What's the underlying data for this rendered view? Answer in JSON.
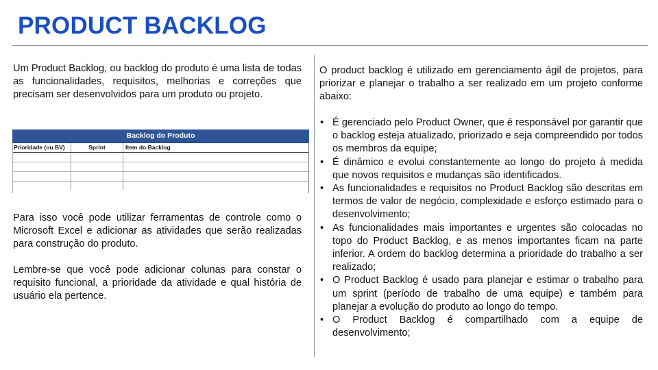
{
  "header": {
    "title": "PRODUCT BACKLOG",
    "title_color": "#1a4fc0"
  },
  "left": {
    "intro": "Um Product Backlog, ou backlog do produto é uma lista de todas as funcionalidades, requisitos, melhorias e correções que precisam ser desenvolvidos para um produto ou projeto.",
    "table": {
      "title": "Backlog do Produto",
      "header_color": "#2f5597",
      "columns": [
        "Prioridade (ou BV)",
        "Sprint",
        "Item do Backlog"
      ],
      "empty_rows": 4
    },
    "tools_paragraph": "Para isso você pode utilizar ferramentas de controle como o Microsoft Excel e adicionar as atividades que serão realizadas para construção do produto.",
    "columns_paragraph": "Lembre-se que você pode adicionar colunas para constar o requisito funcional, a prioridade da atividade e qual história de usuário ela pertence."
  },
  "right": {
    "intro": "O product backlog é utilizado em gerenciamento ágil de projetos, para priorizar e planejar o trabalho a ser realizado em um projeto conforme abaixo:",
    "bullet_symbol": "•",
    "bullets": [
      "É gerenciado pelo Product Owner, que é responsável por garantir que o backlog esteja atualizado, priorizado e seja compreendido por todos os membros da equipe;",
      "É dinâmico e evolui constantemente ao longo do projeto à medida que novos requisitos e mudanças são identificados.",
      "As funcionalidades e requisitos no Product Backlog são descritas em termos de valor de negócio, complexidade e esforço estimado para o desenvolvimento;",
      "As funcionalidades mais importantes e urgentes são colocadas no topo do Product Backlog, e as menos importantes ficam na parte inferior. A ordem do backlog determina a prioridade do trabalho a ser realizado;",
      "O Product Backlog é usado para planejar e estimar o trabalho para um sprint (período de trabalho de uma equipe) e também para planejar a evolução do produto ao longo do tempo.",
      "O Product Backlog é compartilhado com a equipe de desenvolvimento;"
    ]
  }
}
